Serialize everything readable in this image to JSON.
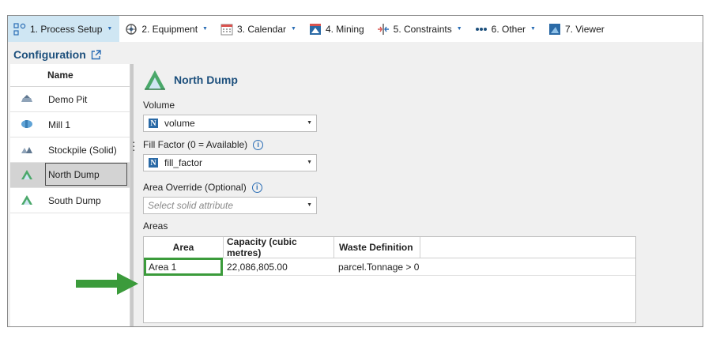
{
  "toolbar": {
    "items": [
      {
        "label": "1. Process Setup",
        "icon": "process-setup-icon",
        "caret": "▼"
      },
      {
        "label": "2. Equipment",
        "icon": "equipment-icon",
        "caret": "▼"
      },
      {
        "label": "3. Calendar",
        "icon": "calendar-icon",
        "caret": "▼"
      },
      {
        "label": "4. Mining",
        "icon": "mining-icon",
        "caret": ""
      },
      {
        "label": "5. Constraints",
        "icon": "constraints-icon",
        "caret": "▼"
      },
      {
        "label": "6. Other",
        "icon": "other-icon",
        "caret": "▼"
      },
      {
        "label": "7. Viewer",
        "icon": "viewer-icon",
        "caret": ""
      }
    ]
  },
  "config": {
    "title": "Configuration",
    "column_name": "Name",
    "items": [
      {
        "label": "Demo Pit",
        "icon": "pit-icon"
      },
      {
        "label": "Mill 1",
        "icon": "mill-icon"
      },
      {
        "label": "Stockpile (Solid)",
        "icon": "stockpile-icon"
      },
      {
        "label": "North Dump",
        "icon": "dump-icon",
        "selected": true
      },
      {
        "label": "South Dump",
        "icon": "dump-icon"
      }
    ]
  },
  "detail": {
    "title": "North Dump",
    "volume": {
      "label": "Volume",
      "value": "volume",
      "badge": "N"
    },
    "fill_factor": {
      "label": "Fill Factor (0 = Available)",
      "value": "fill_factor",
      "badge": "N",
      "info": "i"
    },
    "area_override": {
      "label": "Area Override (Optional)",
      "placeholder": "Select solid attribute",
      "info": "i"
    },
    "areas": {
      "label": "Areas",
      "columns": [
        "Area",
        "Capacity (cubic metres)",
        "Waste Definition"
      ],
      "rows": [
        {
          "area": "Area 1",
          "capacity": "22,086,805.00",
          "waste": "parcel.Tonnage > 0"
        }
      ]
    }
  },
  "colors": {
    "accent_blue": "#1c4f7c",
    "active_tab": "#cfe6f3",
    "highlight_green": "#3b9b3b",
    "selected_row": "#d3d3d3"
  }
}
